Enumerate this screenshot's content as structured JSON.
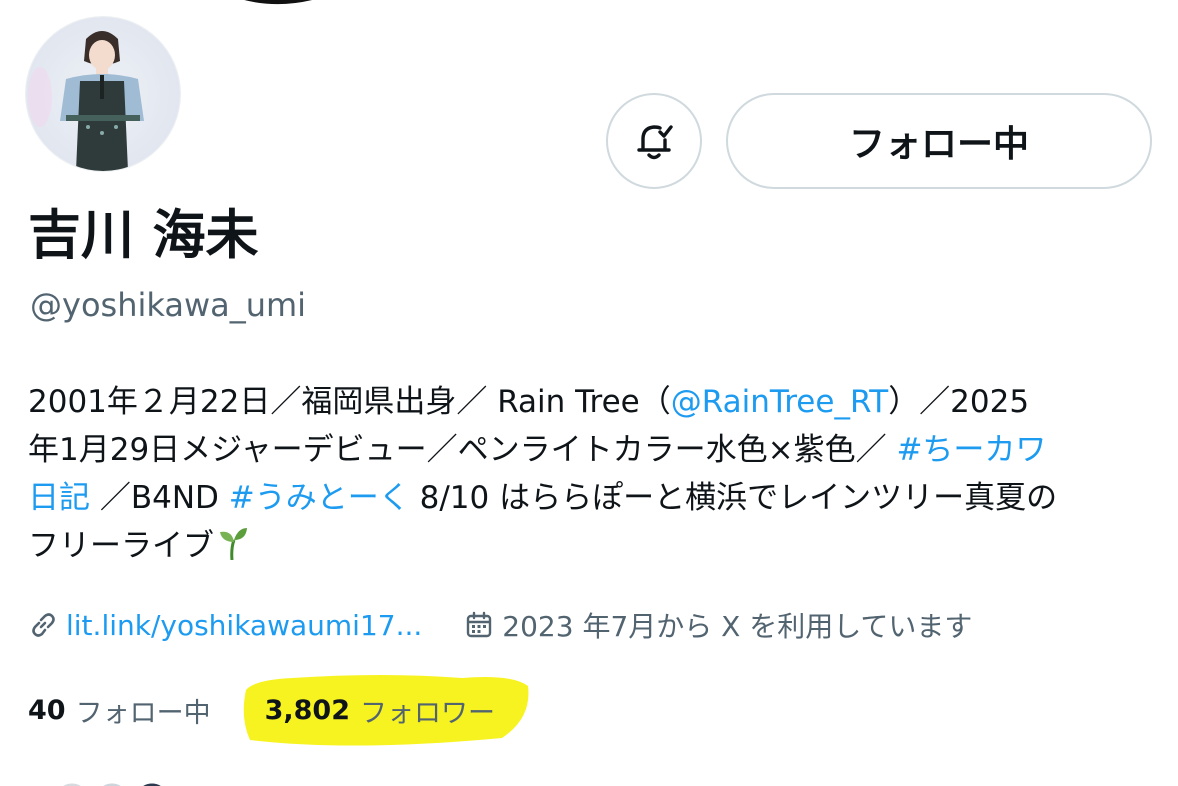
{
  "profile": {
    "display_name": "吉川 海未",
    "handle": "@yoshikawa_umi"
  },
  "actions": {
    "notify_icon": "bell-check-icon",
    "follow_label": "フォロー中"
  },
  "bio": {
    "line1_a": "2001年２月22日／福岡県出身／ Rain Tree（",
    "line1_mention": "@RainTree_RT",
    "line1_b": "）／2025",
    "line2_a": "年1月29日メジャーデビュー／ペンライトカラー水色×紫色／ ",
    "line2_hashtag": "#ちーカワ",
    "line3_hashtag_cont": "日記",
    "line3_a": " ／B4ND ",
    "line3_hashtag2": "#うみとーく",
    "line3_b": " 8/10 はららぽーと横浜でレインツリー真夏の",
    "line4": "フリーライブ",
    "line4_emoji_icon": "seedling-icon"
  },
  "meta": {
    "link_icon": "link-icon",
    "link_text": "lit.link/yoshikawaumi17...",
    "calendar_icon": "calendar-icon",
    "joined_text": "2023 年7月から X を利用しています"
  },
  "stats": {
    "following_count": "40",
    "following_label": "フォロー中",
    "followers_count": "3,802",
    "followers_label": "フォロワー"
  },
  "colors": {
    "accent": "#1d9bf0",
    "secondary_text": "#536471",
    "border": "#cfd9de",
    "highlight": "#f7f214"
  }
}
